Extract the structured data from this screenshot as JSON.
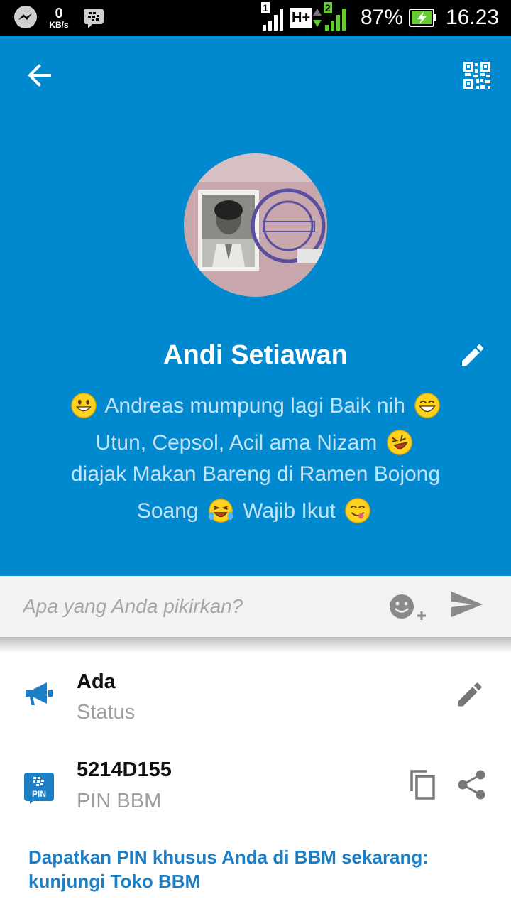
{
  "status_bar": {
    "net_speed": "0",
    "net_unit": "KB/s",
    "sim1": "1",
    "network_type": "H+",
    "sim2": "2",
    "battery": "87%",
    "time": "16.23"
  },
  "profile": {
    "name": "Andi Setiawan",
    "bio_lines": [
      "Andreas mumpung lagi Baik nih",
      "Utun, Cepsol, Acil ama Nizam",
      "diajak Makan Bareng di Ramen Bojong",
      "Soang",
      "Wajib Ikut"
    ]
  },
  "post": {
    "placeholder": "Apa yang Anda pikirkan?"
  },
  "details": {
    "status_value": "Ada",
    "status_label": "Status",
    "pin_value": "5214D155",
    "pin_label": "PIN BBM",
    "pin_badge": "PIN"
  },
  "promo": {
    "line1": "Dapatkan PIN khusus Anda di BBM sekarang:",
    "line2": "kunjungi Toko BBM"
  },
  "colors": {
    "header_bg": "#0189cf",
    "accent": "#1c7fc5",
    "bio_text": "#c4e3f6"
  }
}
